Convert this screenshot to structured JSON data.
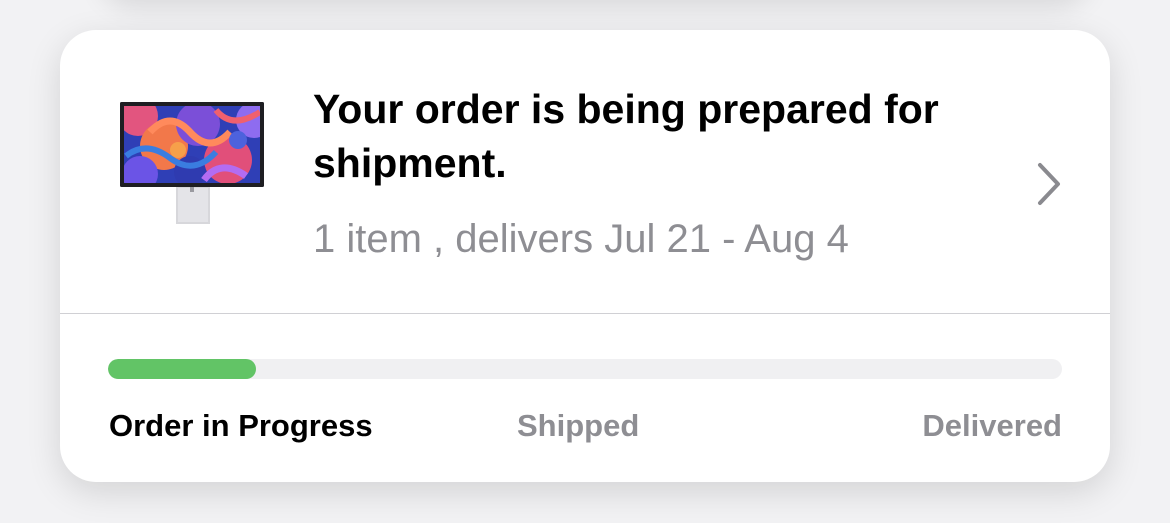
{
  "order": {
    "title": "Your order is being prepared for shipment.",
    "summary": "1 item , delivers Jul 21 - Aug 4",
    "product_icon": "studio-display-thumbnail"
  },
  "progress": {
    "value": 0.155,
    "stages": [
      "Order in Progress",
      "Shipped",
      "Delivered"
    ],
    "current_stage": "Order in Progress"
  },
  "colors": {
    "progress_fill": "#62c466",
    "progress_track": "#f0f0f2",
    "secondary_text": "#8e8e93",
    "primary_text": "#000000"
  },
  "icons": {
    "chevron": "chevron-right-icon"
  }
}
